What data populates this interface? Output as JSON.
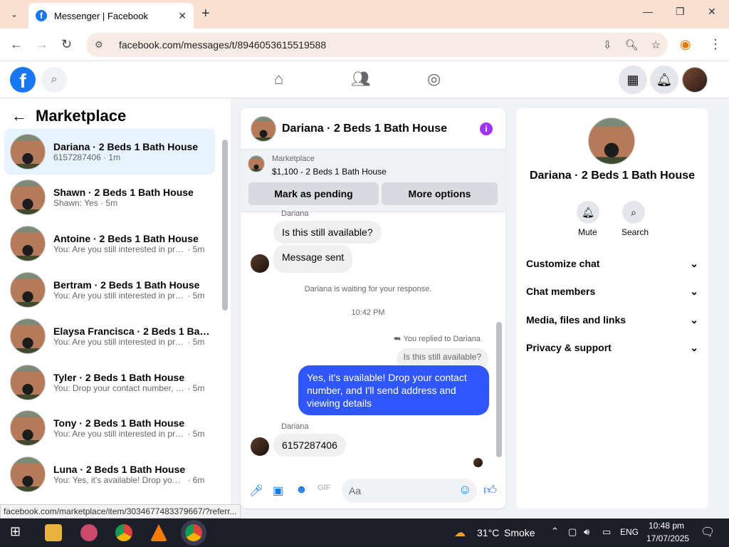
{
  "browser": {
    "tab_title": "Messenger | Facebook",
    "url": "facebook.com/messages/t/8946053615519588"
  },
  "left": {
    "title": "Marketplace",
    "conversations": [
      {
        "name": "Dariana · 2 Beds 1 Bath House",
        "msg": "6157287406",
        "time": "1m"
      },
      {
        "name": "Shawn · 2 Beds 1 Bath House",
        "msg": "Shawn: Yes",
        "time": "5m"
      },
      {
        "name": "Antoine · 2 Beds 1 Bath House",
        "msg": "You: Are you still interested in pro...",
        "time": "5m"
      },
      {
        "name": "Bertram · 2 Beds 1 Bath House",
        "msg": "You: Are you still interested in pro...",
        "time": "5m"
      },
      {
        "name": "Elaysa Francisca · 2 Beds 1 Bath ...",
        "msg": "You: Are you still interested in pro...",
        "time": "5m"
      },
      {
        "name": "Tyler · 2 Beds 1 Bath House",
        "msg": "You: Drop your contact number, a...",
        "time": "5m"
      },
      {
        "name": "Tony · 2 Beds 1 Bath House",
        "msg": "You: Are you still interested in pro...",
        "time": "5m"
      },
      {
        "name": "Luna · 2 Beds 1 Bath House",
        "msg": "You: Yes, it's available! Drop your c...",
        "time": "6m"
      }
    ]
  },
  "chat": {
    "title": "Dariana · 2 Beds 1 Bath House",
    "listing_source": "Marketplace",
    "listing_price": "$1,100 - 2 Beds 1 Bath House",
    "mark_pending": "Mark as pending",
    "more_options": "More options",
    "sender_top": "Dariana",
    "msg1": "Is this still available?",
    "msg2": "Message sent",
    "waiting": "Dariana is waiting for your response.",
    "time": "10:42 PM",
    "replied": "You replied to Dariana",
    "quoted": "Is this still available?",
    "out_msg": "Yes, it's available! Drop your contact number, and I'll send address and viewing details",
    "sender_bottom": "Dariana",
    "msg3": "6157287406",
    "composer_placeholder": "Aa"
  },
  "right": {
    "title": "Dariana · 2 Beds 1 Bath House",
    "mute": "Mute",
    "search": "Search",
    "sections": [
      "Customize chat",
      "Chat members",
      "Media, files and links",
      "Privacy & support"
    ]
  },
  "status_url": "facebook.com/marketplace/item/3034677483379667/?referr...",
  "taskbar": {
    "temp": "31°C",
    "weather": "Smoke",
    "lang": "ENG",
    "time": "10:48 pm",
    "date": "17/07/2025"
  },
  "colors": {
    "brand": "#1877f2",
    "outgoing": "#3056ff",
    "info": "#a033ff"
  }
}
